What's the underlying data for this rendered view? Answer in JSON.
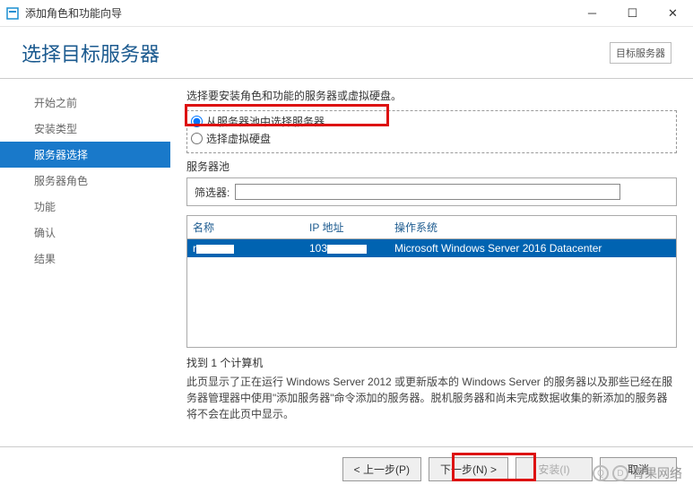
{
  "window": {
    "title": "添加角色和功能向导"
  },
  "header": {
    "page_title": "选择目标服务器",
    "target_label": "目标服务器"
  },
  "sidebar": {
    "items": [
      {
        "label": "开始之前"
      },
      {
        "label": "安装类型"
      },
      {
        "label": "服务器选择"
      },
      {
        "label": "服务器角色"
      },
      {
        "label": "功能"
      },
      {
        "label": "确认"
      },
      {
        "label": "结果"
      }
    ]
  },
  "main": {
    "instruction": "选择要安装角色和功能的服务器或虚拟硬盘。",
    "radio_pool": "从服务器池中选择服务器",
    "radio_vhd": "选择虚拟硬盘",
    "pool_label": "服务器池",
    "filter_label": "筛选器:",
    "filter_value": "",
    "columns": {
      "name": "名称",
      "ip": "IP 地址",
      "os": "操作系统"
    },
    "rows": [
      {
        "name_prefix": "r",
        "ip_prefix": "103",
        "os": "Microsoft Windows Server 2016 Datacenter"
      }
    ],
    "found": "找到 1 个计算机",
    "description": "此页显示了正在运行 Windows Server 2012 或更新版本的 Windows Server 的服务器以及那些已经在服务器管理器中使用\"添加服务器\"命令添加的服务器。脱机服务器和尚未完成数据收集的新添加的服务器将不会在此页中显示。"
  },
  "footer": {
    "prev": "< 上一步(P)",
    "next": "下一步(N) >",
    "install": "安装(I)",
    "cancel": "取消"
  },
  "watermark": {
    "a": "Q",
    "b": "D",
    "text": "青果网络"
  }
}
